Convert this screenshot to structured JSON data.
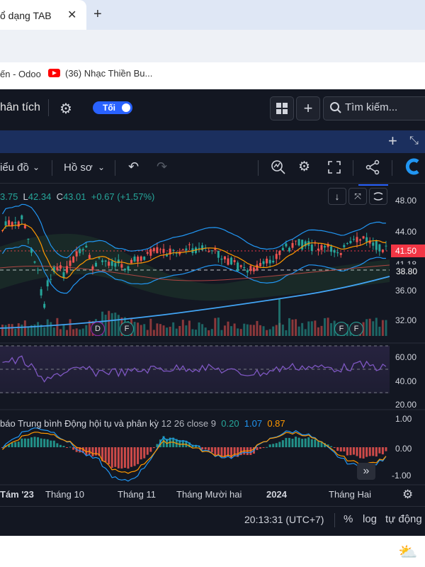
{
  "browser": {
    "tab_title": "ổ dạng TAB",
    "bookmarks": [
      "ến - Odoo",
      "(36) Nhạc Thiền Bu..."
    ]
  },
  "app": {
    "topbar": {
      "analysis_label": "hân tích",
      "theme_toggle_label": "Tối",
      "search_placeholder": "Tìm kiếm..."
    },
    "toolbar": {
      "chart_type_label": "iểu đồ",
      "profile_label": "Hồ sơ"
    },
    "ohlc": {
      "o_value": "3.75",
      "l_label": "L",
      "l_value": "42.34",
      "c_label": "C",
      "c_value": "43.01",
      "change": "+0.67 (+1.57%)"
    },
    "price_axis": {
      "ticks": [
        "48.00",
        "44.00",
        "36.00",
        "32.00"
      ],
      "current_price": "41.50",
      "partial_label": "41.18",
      "line_label": "38.80"
    },
    "rsi_axis": [
      "60.00",
      "40.00",
      "20.00"
    ],
    "macd": {
      "title": "báo Trung bình Động hội tụ và phân kỳ",
      "params": "12 26 close 9",
      "v1": "0.20",
      "v2": "1.07",
      "v3": "0.87",
      "axis": [
        "1.00",
        "0.00",
        "-1.00"
      ]
    },
    "time_axis": [
      "Tám '23",
      "Tháng 10",
      "Tháng 11",
      "Tháng Mười hai",
      "2024",
      "Tháng Hai"
    ],
    "event_markers": [
      "D",
      "F",
      "F",
      "F"
    ],
    "bottom_bar": {
      "time": "20:13:31 (UTC+7)",
      "percent_label": "%",
      "log_label": "log",
      "auto_label": "tự động"
    }
  },
  "colors": {
    "background": "#131722",
    "up": "#26a69a",
    "down": "#ef5350",
    "rsi": "#7e57c2",
    "bollinger": "#2196f3",
    "ma_orange": "#ff9800",
    "current_price": "#f23645",
    "accent": "#2962ff"
  },
  "icons": [
    "close-icon",
    "plus-icon",
    "gear-icon",
    "grid-icon",
    "search-icon",
    "chevron-down-icon",
    "undo-icon",
    "redo-icon",
    "indicators-icon",
    "settings-icon",
    "fullscreen-icon",
    "share-icon",
    "arrow-down-icon",
    "collapse-icon",
    "more-icon",
    "forward-icon",
    "gear-icon",
    "weather-icon"
  ]
}
